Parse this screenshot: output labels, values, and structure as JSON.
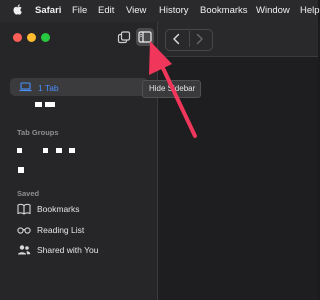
{
  "menubar": {
    "app_name": "Safari",
    "items": [
      "File",
      "Edit",
      "View",
      "History",
      "Bookmarks",
      "Window",
      "Help"
    ]
  },
  "toolbar": {
    "tooltip": "Hide Sidebar"
  },
  "sidebar": {
    "tab_row_label": "1 Tab",
    "tab_groups_heading": "Tab Groups",
    "saved_heading": "Saved",
    "saved_items": [
      {
        "label": "Bookmarks",
        "icon": "book-icon"
      },
      {
        "label": "Reading List",
        "icon": "glasses-icon"
      },
      {
        "label": "Shared with You",
        "icon": "people-icon"
      }
    ]
  },
  "colors": {
    "accent": "#4a90ff",
    "arrow": "#f0365a",
    "traffic_red": "#fe5f57",
    "traffic_yellow": "#febc2e",
    "traffic_green": "#28c840"
  }
}
